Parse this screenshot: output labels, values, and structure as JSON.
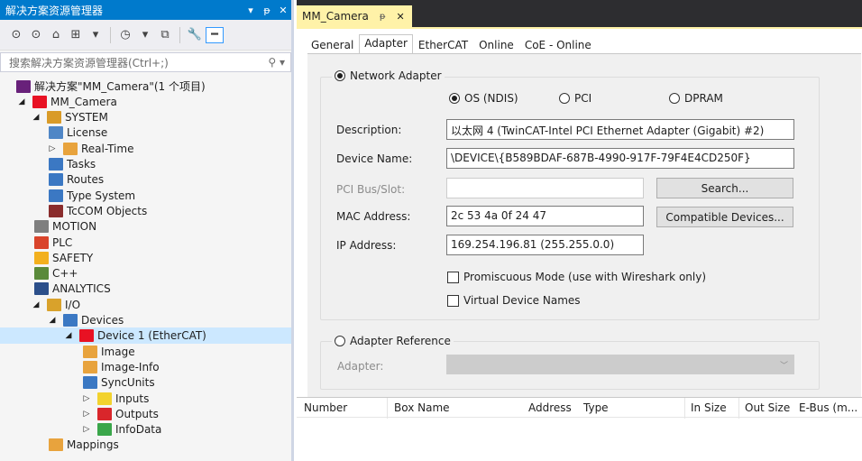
{
  "explorer": {
    "title": "解决方案资源管理器",
    "title_buttons": [
      "▾",
      "ᵽ",
      "✕"
    ],
    "search_placeholder": "搜索解决方案资源管理器(Ctrl+;)",
    "search_icon": "search-icon"
  },
  "tree": [
    {
      "label": "解决方案\"MM_Camera\"(1 个项目)",
      "icon": "solution-icon",
      "expander": "",
      "color": "#68217a"
    },
    {
      "label": "MM_Camera",
      "icon": "project-icon",
      "expander": "◢",
      "color": "#e81123"
    },
    {
      "label": "SYSTEM",
      "icon": "system-icon",
      "expander": "◢",
      "color": "#d99b28"
    },
    {
      "label": "License",
      "icon": "license-icon",
      "expander": "",
      "color": "#4f86c6"
    },
    {
      "label": "Real-Time",
      "icon": "realtime-icon",
      "expander": "▷",
      "color": "#e8a33d"
    },
    {
      "label": "Tasks",
      "icon": "tasks-icon",
      "expander": "",
      "color": "#3b78c3"
    },
    {
      "label": "Routes",
      "icon": "routes-icon",
      "expander": "",
      "color": "#3b78c3"
    },
    {
      "label": "Type System",
      "icon": "type-system-icon",
      "expander": "",
      "color": "#3b78c3"
    },
    {
      "label": "TcCOM Objects",
      "icon": "tccom-icon",
      "expander": "",
      "color": "#8a2c2c"
    },
    {
      "label": "MOTION",
      "icon": "motion-icon",
      "expander": "",
      "color": "#7f7f7f"
    },
    {
      "label": "PLC",
      "icon": "plc-icon",
      "expander": "",
      "color": "#d9442b"
    },
    {
      "label": "SAFETY",
      "icon": "safety-icon",
      "expander": "",
      "color": "#f2b01e"
    },
    {
      "label": "C++",
      "icon": "cpp-icon",
      "expander": "",
      "color": "#5a8a3a"
    },
    {
      "label": "ANALYTICS",
      "icon": "analytics-icon",
      "expander": "",
      "color": "#2c4f8a"
    },
    {
      "label": "I/O",
      "icon": "io-icon",
      "expander": "◢",
      "color": "#d9a22b"
    },
    {
      "label": "Devices",
      "icon": "devices-icon",
      "expander": "◢",
      "color": "#3b78c3"
    },
    {
      "label": "Device 1 (EtherCAT)",
      "icon": "ethercat-device-icon",
      "expander": "◢",
      "color": "#e81123"
    },
    {
      "label": "Image",
      "icon": "image-icon",
      "expander": "",
      "color": "#e8a33d"
    },
    {
      "label": "Image-Info",
      "icon": "image-info-icon",
      "expander": "",
      "color": "#e8a33d"
    },
    {
      "label": "SyncUnits",
      "icon": "syncunits-icon",
      "expander": "",
      "color": "#3b78c3"
    },
    {
      "label": "Inputs",
      "icon": "inputs-icon",
      "expander": "▷",
      "color": "#f2d22e"
    },
    {
      "label": "Outputs",
      "icon": "outputs-icon",
      "expander": "▷",
      "color": "#d9262b"
    },
    {
      "label": "InfoData",
      "icon": "infodata-icon",
      "expander": "▷",
      "color": "#3aa64a"
    },
    {
      "label": "Mappings",
      "icon": "mappings-icon",
      "expander": "",
      "color": "#e8a33d"
    }
  ],
  "document": {
    "tab_label": "MM_Camera",
    "pin_glyph": "ᵽ",
    "close_glyph": "✕",
    "prop_tabs": [
      "General",
      "Adapter",
      "EtherCAT",
      "Online",
      "CoE - Online"
    ],
    "active_tab": "Adapter"
  },
  "adapter": {
    "network_adapter_label": "Network Adapter",
    "network_adapter_selected": true,
    "mode_options": [
      "OS (NDIS)",
      "PCI",
      "DPRAM"
    ],
    "mode_selected": "OS (NDIS)",
    "description_label": "Description:",
    "description_value": "以太网 4 (TwinCAT-Intel PCI Ethernet Adapter (Gigabit) #2)",
    "device_name_label": "Device Name:",
    "device_name_value": "\\DEVICE\\{B589BDAF-687B-4990-917F-79F4E4CD250F}",
    "pci_label": "PCI Bus/Slot:",
    "pci_value": "",
    "search_button": "Search...",
    "mac_label": "MAC Address:",
    "mac_value": "2c 53 4a 0f 24 47",
    "compatible_button": "Compatible Devices...",
    "ip_label": "IP Address:",
    "ip_value": "169.254.196.81 (255.255.0.0)",
    "promiscuous_label": "Promiscuous Mode (use with Wireshark only)",
    "promiscuous_checked": false,
    "virtual_names_label": "Virtual Device Names",
    "virtual_names_checked": false,
    "adapter_reference_label": "Adapter Reference",
    "adapter_reference_selected": false,
    "adapter_label": "Adapter:",
    "adapter_value": ""
  },
  "grid": {
    "columns": [
      "Number",
      "Box Name",
      "Address",
      "Type",
      "In Size",
      "Out Size",
      "E-Bus (m..."
    ]
  }
}
